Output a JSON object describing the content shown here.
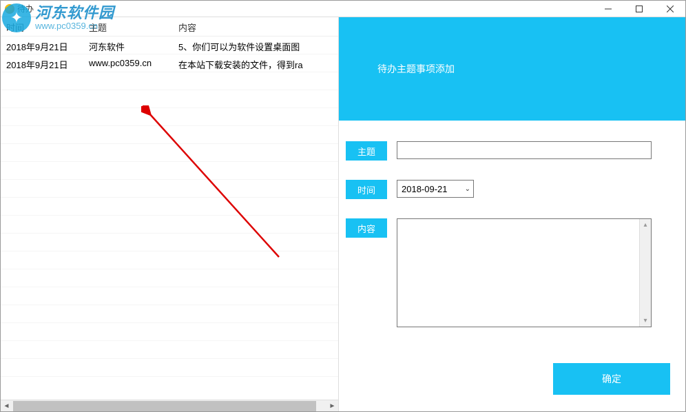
{
  "window": {
    "title": "待办"
  },
  "table": {
    "headers": {
      "time": "时间",
      "subject": "主题",
      "content": "内容"
    },
    "rows": [
      {
        "time": "2018年9月21日",
        "subject": "河东软件",
        "content": "5、你们可以为软件设置桌面图"
      },
      {
        "time": "2018年9月21日",
        "subject": "www.pc0359.cn",
        "content": "在本站下载安装的文件，得到ra"
      }
    ]
  },
  "panel": {
    "title": "待办主题事项添加",
    "labels": {
      "subject": "主题",
      "time": "时间",
      "content": "内容"
    },
    "dateValue": "2018-09-21",
    "confirmLabel": "确定"
  },
  "watermark": {
    "brand": "河东软件园",
    "url": "www.pc0359.cn"
  }
}
